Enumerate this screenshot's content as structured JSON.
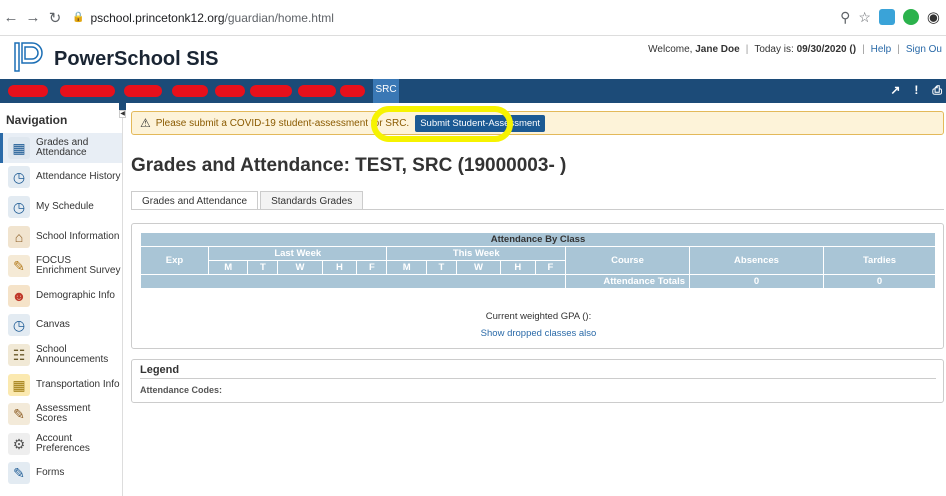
{
  "browser": {
    "url_host": "pschool.princetonk12.org",
    "url_path": "/guardian/home.html",
    "back_icon": "arrow-left",
    "forward_icon": "arrow-right",
    "reload_icon": "reload"
  },
  "header": {
    "app_name": "PowerSchool SIS",
    "welcome_prefix": "Welcome,",
    "user_name": "Jane Doe",
    "today_prefix": "Today is:",
    "today_value": "09/30/2020 ()",
    "help_link": "Help",
    "signout_link": "Sign Ou"
  },
  "topbar": {
    "student_tab": "SRC"
  },
  "sidebar": {
    "title": "Navigation",
    "items": [
      {
        "label": "Grades and Attendance",
        "icon": "grades-icon"
      },
      {
        "label": "Attendance History",
        "icon": "attendance-history-icon"
      },
      {
        "label": "My Schedule",
        "icon": "schedule-icon"
      },
      {
        "label": "School Information",
        "icon": "school-icon"
      },
      {
        "label": "FOCUS Enrichment Survey",
        "icon": "survey-icon"
      },
      {
        "label": "Demographic Info",
        "icon": "demographic-icon"
      },
      {
        "label": "Canvas",
        "icon": "canvas-icon"
      },
      {
        "label": "School Announcements",
        "icon": "announcements-icon"
      },
      {
        "label": "Transportation Info",
        "icon": "bus-icon"
      },
      {
        "label": "Assessment Scores",
        "icon": "assessment-icon"
      },
      {
        "label": "Account Preferences",
        "icon": "preferences-icon"
      },
      {
        "label": "Forms",
        "icon": "forms-icon"
      }
    ]
  },
  "alert": {
    "message": "Please submit a COVID-19 student-assessment for SRC.",
    "button_label": "Submit Student-Assessment"
  },
  "main": {
    "title": "Grades and Attendance: TEST, SRC (19000003- )",
    "tabs": [
      "Grades and Attendance",
      "Standards Grades"
    ]
  },
  "attendance_table": {
    "caption": "Attendance By Class",
    "exp_header": "Exp",
    "last_week": "Last Week",
    "this_week": "This Week",
    "days": [
      "M",
      "T",
      "W",
      "H",
      "F"
    ],
    "course_header": "Course",
    "absences_header": "Absences",
    "tardies_header": "Tardies",
    "totals_label": "Attendance Totals",
    "total_absences": "0",
    "total_tardies": "0"
  },
  "gpa_text": "Current weighted GPA ():",
  "dropped_link": "Show dropped classes also",
  "legend": {
    "title": "Legend",
    "codes_label": "Attendance Codes:"
  },
  "colors": {
    "primary_bar": "#1c4b78",
    "table_header": "#a9c5d6",
    "alert_bg": "#fdf3d9",
    "highlight": "#f6f300"
  }
}
